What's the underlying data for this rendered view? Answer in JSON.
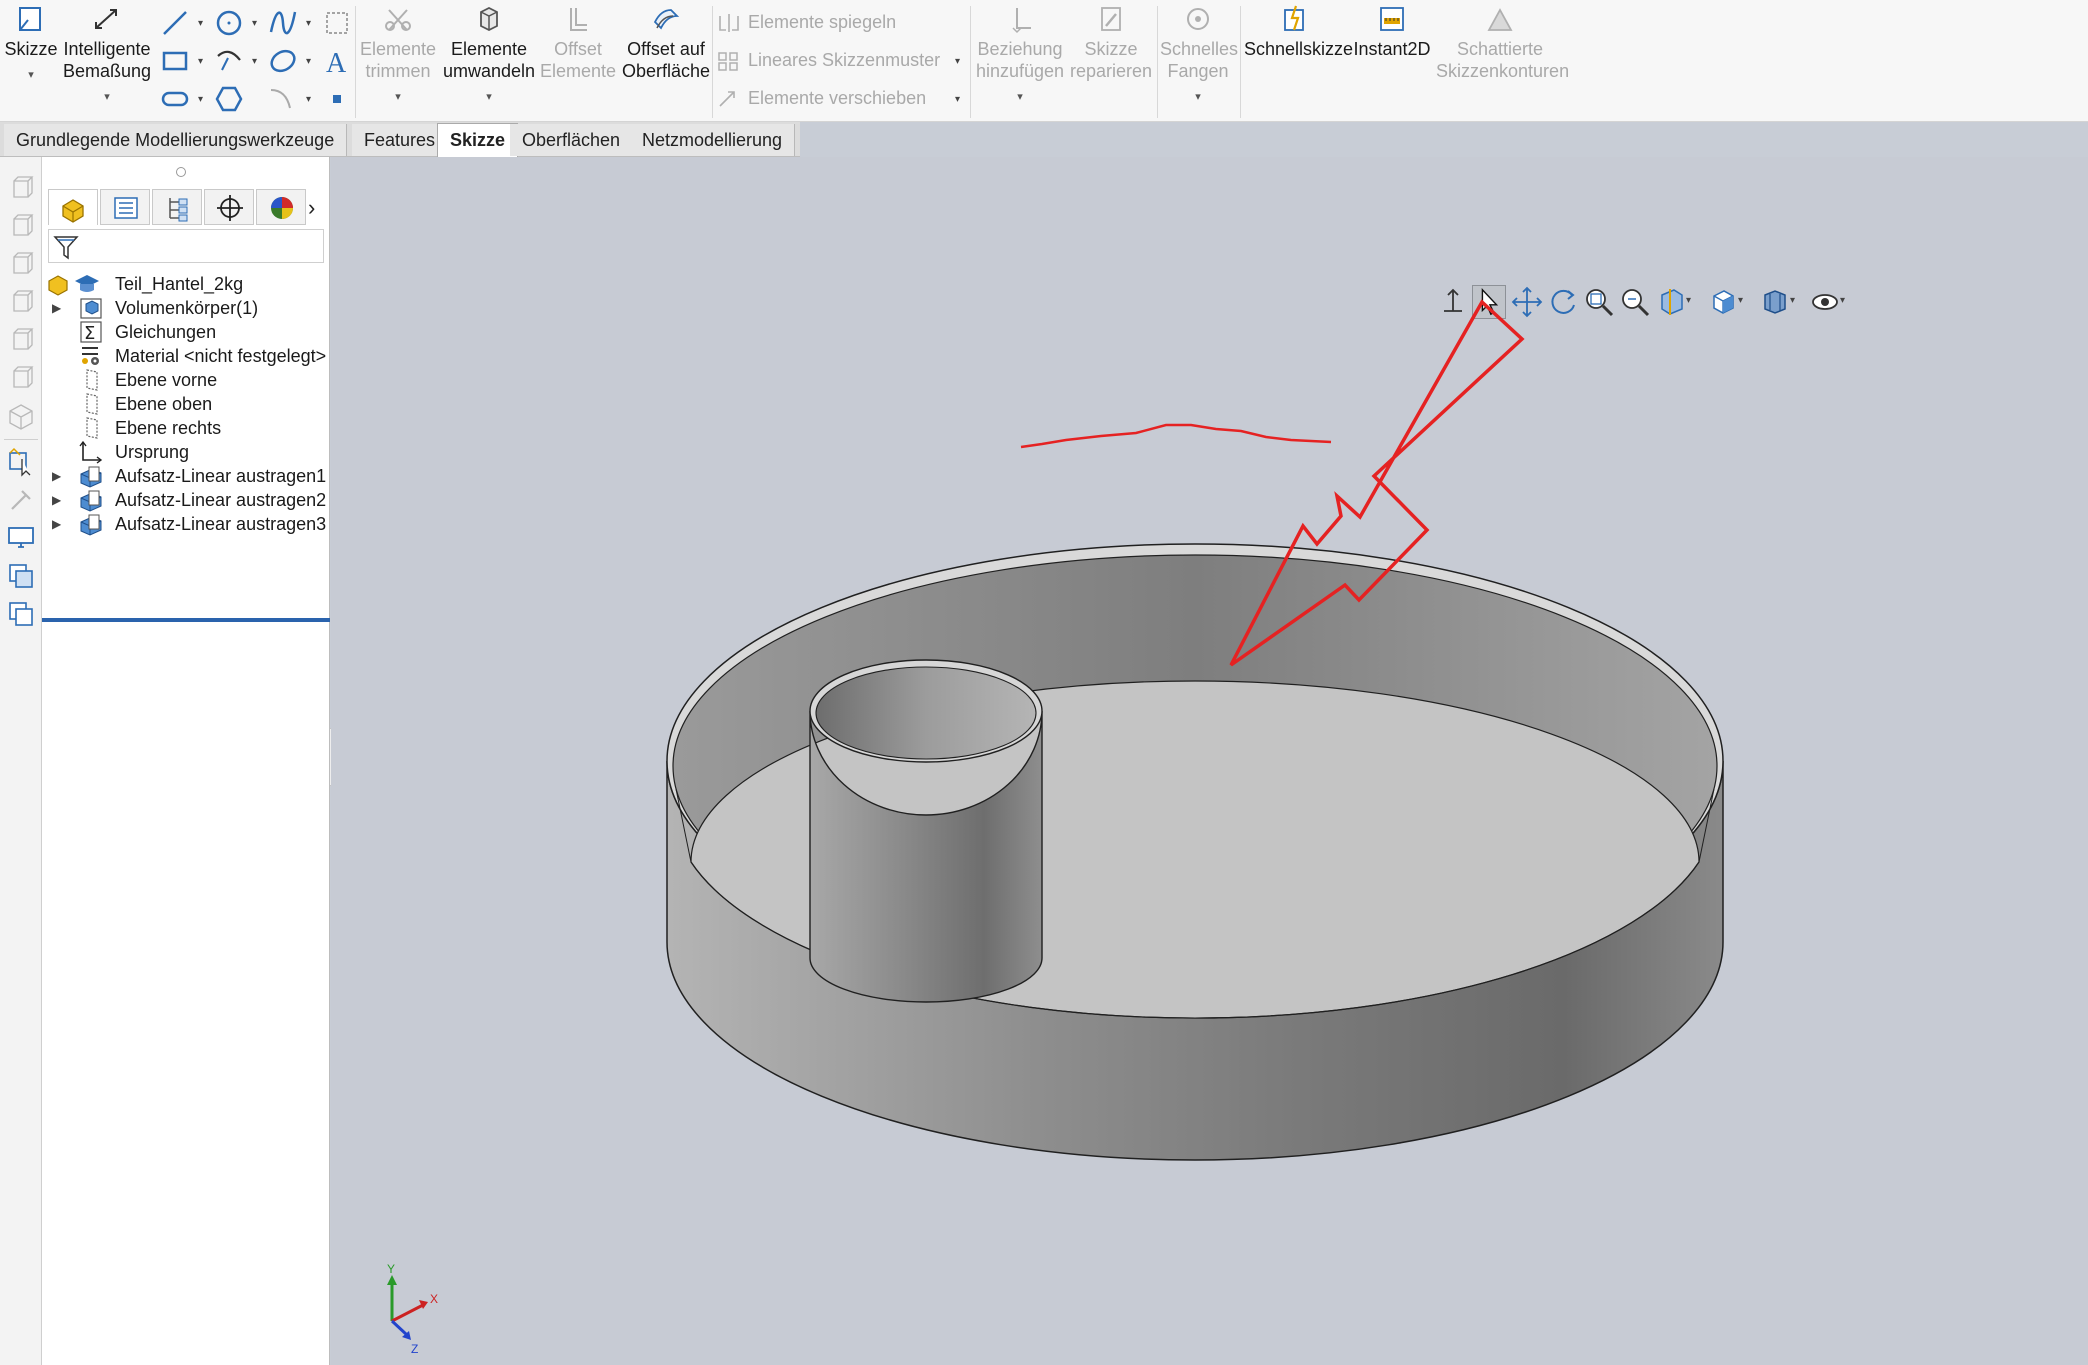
{
  "ribbon": {
    "sketch": {
      "label": "Skizze"
    },
    "smart_dimension": {
      "label": "Intelligente\nBemaßung"
    },
    "trim": {
      "label": "Elemente\ntrimmen"
    },
    "convert": {
      "label": "Elemente\numwandeln"
    },
    "offset": {
      "label": "Offset\nElemente"
    },
    "offset_surface": {
      "label": "Offset auf\nOberfläche"
    },
    "mirror": {
      "label": "Elemente spiegeln"
    },
    "linear_pattern": {
      "label": "Lineares Skizzenmuster"
    },
    "move": {
      "label": "Elemente verschieben"
    },
    "add_relation": {
      "label": "Beziehung\nhinzufügen"
    },
    "repair": {
      "label": "Skizze\nreparieren"
    },
    "quick_snaps": {
      "label": "Schnelles\nFangen"
    },
    "rapid_sketch": {
      "label": "Schnellskizze"
    },
    "instant2d": {
      "label": "Instant2D"
    },
    "shaded_contours": {
      "label": "Schattierte\nSkizzenkonturen"
    }
  },
  "tabs": [
    {
      "label": "Grundlegende Modellierungswerkzeuge"
    },
    {
      "label": "Features"
    },
    {
      "label": "Skizze"
    },
    {
      "label": "Oberflächen"
    },
    {
      "label": "Netzmodellierung"
    }
  ],
  "active_tab": "Skizze",
  "tree": {
    "items": [
      {
        "label": "Teil_Hantel_2kg",
        "icon": "part-icon",
        "expandable": false
      },
      {
        "label": "Volumenkörper(1)",
        "icon": "solid-body-icon",
        "expandable": true
      },
      {
        "label": "Gleichungen",
        "icon": "equations-icon",
        "expandable": false
      },
      {
        "label": "Material <nicht festgelegt>",
        "icon": "material-icon",
        "expandable": false
      },
      {
        "label": "Ebene vorne",
        "icon": "plane-icon",
        "expandable": false
      },
      {
        "label": "Ebene oben",
        "icon": "plane-icon",
        "expandable": false
      },
      {
        "label": "Ebene rechts",
        "icon": "plane-icon",
        "expandable": false
      },
      {
        "label": "Ursprung",
        "icon": "origin-icon",
        "expandable": false
      },
      {
        "label": "Aufsatz-Linear austragen1",
        "icon": "extrude-icon",
        "expandable": true
      },
      {
        "label": "Aufsatz-Linear austragen2",
        "icon": "extrude-icon",
        "expandable": true
      },
      {
        "label": "Aufsatz-Linear austragen3",
        "icon": "extrude-icon",
        "expandable": true
      }
    ]
  },
  "triad": {
    "x": "X",
    "y": "Y",
    "z": "Z"
  },
  "colors": {
    "annotation": "#e52222",
    "accent": "#2a63ad"
  }
}
